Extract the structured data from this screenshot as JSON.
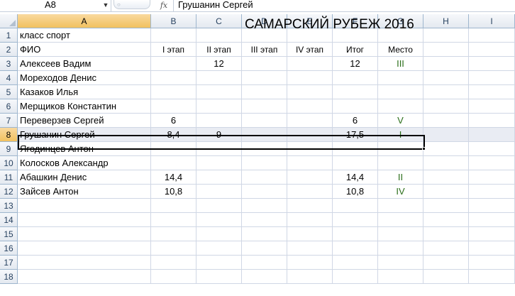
{
  "formula_bar": {
    "name_box": "A8",
    "fx_label": "fx",
    "content": "Грушанин Сергей"
  },
  "columns": [
    "A",
    "B",
    "C",
    "D",
    "E",
    "F",
    "G",
    "H",
    "I"
  ],
  "rows": [
    "1",
    "2",
    "3",
    "4",
    "5",
    "6",
    "7",
    "8",
    "9",
    "10",
    "11",
    "12",
    "13",
    "14",
    "15",
    "16",
    "17",
    "18"
  ],
  "sheet": {
    "a1": "класс  спорт",
    "title": "САМАРСКИЙ РУБЕЖ 2016",
    "headers": {
      "name": "ФИО",
      "stage1": "I этап",
      "stage2": "II этап",
      "stage3": "III этап",
      "stage4": "IV этап",
      "total": "Итог",
      "place": "Место"
    },
    "participants": [
      {
        "name": "Алексеев Вадим",
        "stage1": "",
        "stage2": "12",
        "total": "12",
        "place": "III"
      },
      {
        "name": "Мореходов Денис",
        "stage1": "",
        "stage2": "",
        "total": "",
        "place": ""
      },
      {
        "name": "Казаков Илья",
        "stage1": "",
        "stage2": "",
        "total": "",
        "place": ""
      },
      {
        "name": "Мерщиков Константин",
        "stage1": "",
        "stage2": "",
        "total": "",
        "place": ""
      },
      {
        "name": "Переверзев Сергей",
        "stage1": "6",
        "stage2": "",
        "total": "6",
        "place": "V"
      },
      {
        "name": "Грушанин Сергей",
        "stage1": "8,4",
        "stage2": "9",
        "total": "17,5",
        "place": "I"
      },
      {
        "name": "Ягодинцев Антон",
        "stage1": "",
        "stage2": "",
        "total": "",
        "place": ""
      },
      {
        "name": "Колосков Александр",
        "stage1": "",
        "stage2": "",
        "total": "",
        "place": ""
      },
      {
        "name": "Абашкин Денис",
        "stage1": "14,4",
        "stage2": "",
        "total": "14,4",
        "place": "II"
      },
      {
        "name": "Зайсев Антон",
        "stage1": "10,8",
        "stage2": "",
        "total": "10,8",
        "place": "IV"
      }
    ]
  },
  "colors": {
    "place_text": "#2a6e19",
    "active_header": "#f1c15f",
    "selected_row": "#e9ecf3"
  }
}
